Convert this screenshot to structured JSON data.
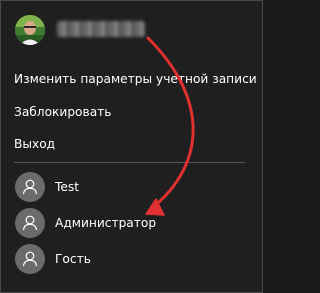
{
  "menu": {
    "change_account_settings": "Изменить параметры учетной записи",
    "lock": "Заблокировать",
    "sign_out": "Выход"
  },
  "users": [
    {
      "name": "Test"
    },
    {
      "name": "Администратор"
    },
    {
      "name": "Гость"
    }
  ],
  "colors": {
    "background": "#1f1f1f",
    "text": "#ffffff",
    "divider": "#555555",
    "avatar": "#6b6b6b",
    "annotation_arrow": "#e03030"
  },
  "icons": {
    "current_user_avatar": "user-photo-icon",
    "user_avatar": "person-icon",
    "annotation": "red-arrow-icon"
  }
}
